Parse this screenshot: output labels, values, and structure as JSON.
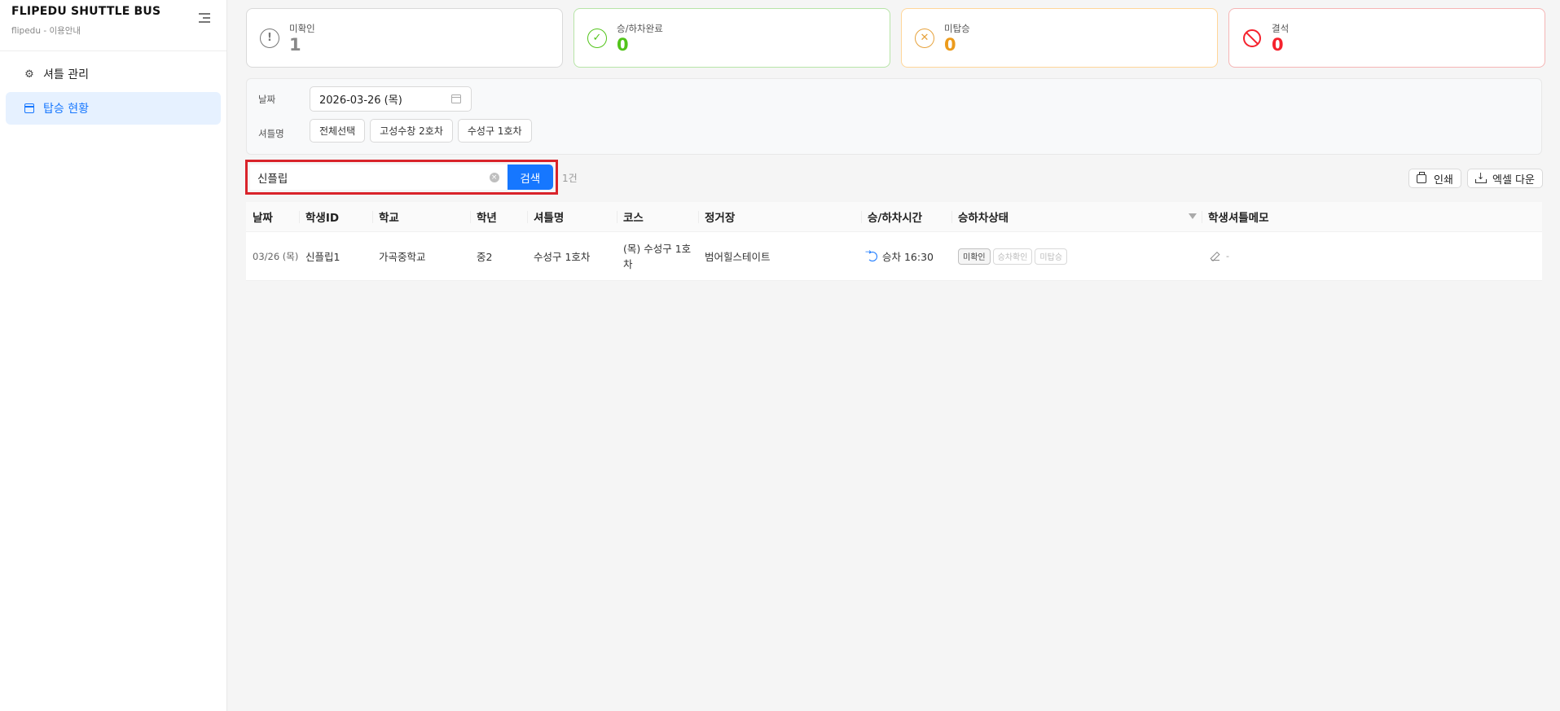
{
  "sidebar": {
    "title": "FLIPEDU SHUTTLE BUS",
    "subtitle": "flipedu - 이용안내",
    "items": [
      {
        "label": "셔틀 관리",
        "icon": "gear-icon",
        "active": false
      },
      {
        "label": "탑승 현황",
        "icon": "calendar-icon",
        "active": true
      }
    ]
  },
  "stats": [
    {
      "label": "미확인",
      "value": "1",
      "icon": "info-circle-icon",
      "color": "#888888"
    },
    {
      "label": "승/하차완료",
      "value": "0",
      "icon": "check-circle-icon",
      "color": "#52c41a"
    },
    {
      "label": "미탑승",
      "value": "0",
      "icon": "close-circle-icon",
      "color": "#ec9b1c"
    },
    {
      "label": "결석",
      "value": "0",
      "icon": "stop-icon",
      "color": "#f5222d"
    }
  ],
  "filters": {
    "date_label": "날짜",
    "date_value": "2026-03-26 (목)",
    "shuttle_label": "셔틀명",
    "shuttle_options": [
      "전체선택",
      "고성수창 2호차",
      "수성구 1호차"
    ]
  },
  "search": {
    "value": "신플립",
    "button_label": "검색",
    "count": "1건"
  },
  "actions": {
    "print_label": "인쇄",
    "excel_label": "엑셀 다운"
  },
  "table": {
    "headers": [
      "날짜",
      "학생ID",
      "학교",
      "학년",
      "셔틀명",
      "코스",
      "정거장",
      "승/하차시간",
      "승하차상태",
      "학생셔틀메모"
    ],
    "rows": [
      {
        "date": "03/26 (목)",
        "student_id": "신플립1",
        "school": "가곡중학교",
        "grade": "중2",
        "shuttle": "수성구 1호차",
        "course": "(목) 수성구 1호차",
        "stop": "범어힐스테이트",
        "time": "승차 16:30",
        "statuses": [
          "미확인",
          "승차확인",
          "미탑승"
        ],
        "memo": "-"
      }
    ]
  },
  "colors": {
    "primary": "#1677ff",
    "highlight_border": "#d9232a"
  }
}
